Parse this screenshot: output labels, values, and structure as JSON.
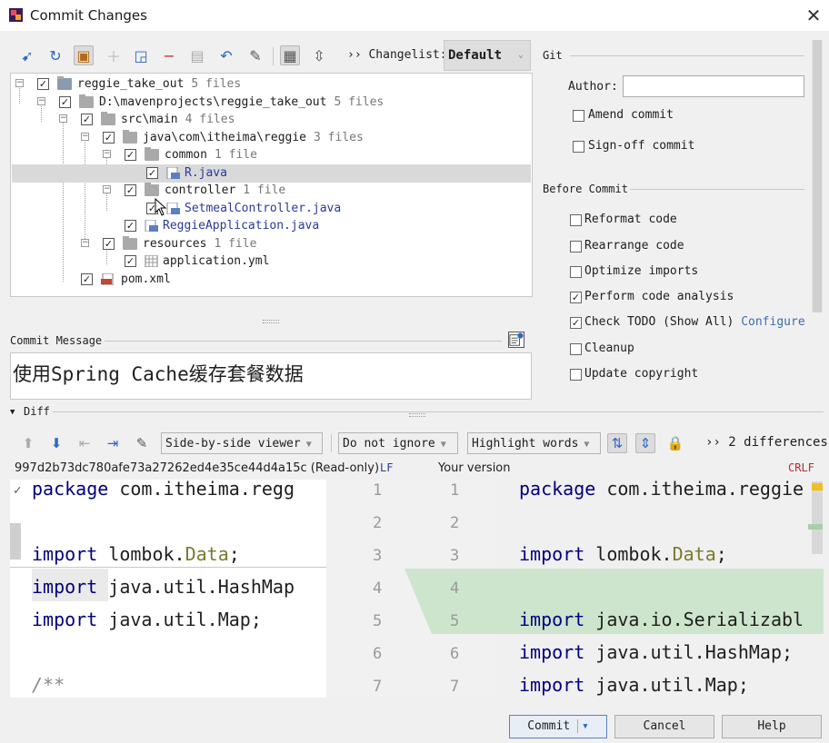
{
  "window": {
    "title": "Commit Changes",
    "close_glyph": "✕"
  },
  "toolbar": {
    "changelist_label": "›› Changelist:",
    "changelist_value": "Default",
    "icons": [
      "diff-arrows-icon",
      "refresh-icon",
      "revert-clipboard-icon",
      "plus-icon",
      "move-icon",
      "minus-icon",
      "move-to-changelist-icon",
      "undo-icon",
      "edit-source-icon",
      "group-by-icon",
      "expand-all-icon"
    ]
  },
  "tree": {
    "rows": [
      {
        "name": "reggie_take_out",
        "count": "5 files"
      },
      {
        "name": "D:\\mavenprojects\\reggie_take_out",
        "count": "5 files"
      },
      {
        "name": "src\\main",
        "count": "4 files"
      },
      {
        "name": "java\\com\\itheima\\reggie",
        "count": "3 files"
      },
      {
        "name": "common",
        "count": "1 file"
      },
      {
        "name": "R.java",
        "count": ""
      },
      {
        "name": "controller",
        "count": "1 file"
      },
      {
        "name": "SetmealController.java",
        "count": ""
      },
      {
        "name": "ReggieApplication.java",
        "count": ""
      },
      {
        "name": "resources",
        "count": "1 file"
      },
      {
        "name": "application.yml",
        "count": ""
      },
      {
        "name": "pom.xml",
        "count": ""
      }
    ]
  },
  "git": {
    "section_title": "Git",
    "author_label": "Author:",
    "author_value": "",
    "amend_commit": "Amend commit",
    "signoff_commit": "Sign-off commit"
  },
  "before_commit": {
    "section_title": "Before Commit",
    "reformat": "Reformat code",
    "rearrange": "Rearrange code",
    "optimize": "Optimize imports",
    "analysis": "Perform code analysis",
    "todo": "Check TODO (Show All)",
    "configure": "Configure",
    "cleanup": "Cleanup",
    "copyright": "Update copyright"
  },
  "commit_message": {
    "label": "Commit Message",
    "value": "使用Spring Cache缓存套餐数据"
  },
  "diff": {
    "label": "Diff",
    "viewer": "Side-by-side viewer",
    "ignore": "Do not ignore",
    "highlight": "Highlight words",
    "count": "›› 2 differences",
    "left_title": "997d2b73dc780afe73a27262ed4e35ce44d4a15c (Read-only)",
    "left_eol": "LF",
    "right_title": "Your version",
    "right_eol": "CRLF",
    "left_lines": [
      {
        "kw": "package",
        "rest": " com.itheima.regg"
      },
      {
        "kw": "",
        "rest": ""
      },
      {
        "kw": "import",
        "rest": " lombok.",
        "cls": "Data",
        "tail": ";"
      },
      {
        "kw": "import",
        "rest": " java.util.HashMap"
      },
      {
        "kw": "import",
        "rest": " java.util.Map;"
      },
      {
        "kw": "",
        "rest": ""
      },
      {
        "kw": "",
        "rest": "/**"
      }
    ],
    "right_lines": [
      {
        "kw": "package",
        "rest": " com.itheima.reggie"
      },
      {
        "kw": "",
        "rest": ""
      },
      {
        "kw": "import",
        "rest": " lombok.",
        "cls": "Data",
        "tail": ";"
      },
      {
        "kw": "",
        "rest": ""
      },
      {
        "kw": "import",
        "rest": " java.io.Serializabl"
      },
      {
        "kw": "import",
        "rest": " java.util.HashMap;"
      },
      {
        "kw": "import",
        "rest": " java.util.Map;"
      }
    ],
    "left_nums": [
      "1",
      "2",
      "3",
      "4",
      "5",
      "6",
      "7"
    ],
    "right_nums": [
      "1",
      "2",
      "3",
      "4",
      "5",
      "6",
      "7"
    ]
  },
  "buttons": {
    "commit": "Commit",
    "commit_arrow": "▾",
    "cancel": "Cancel",
    "help": "Help"
  }
}
